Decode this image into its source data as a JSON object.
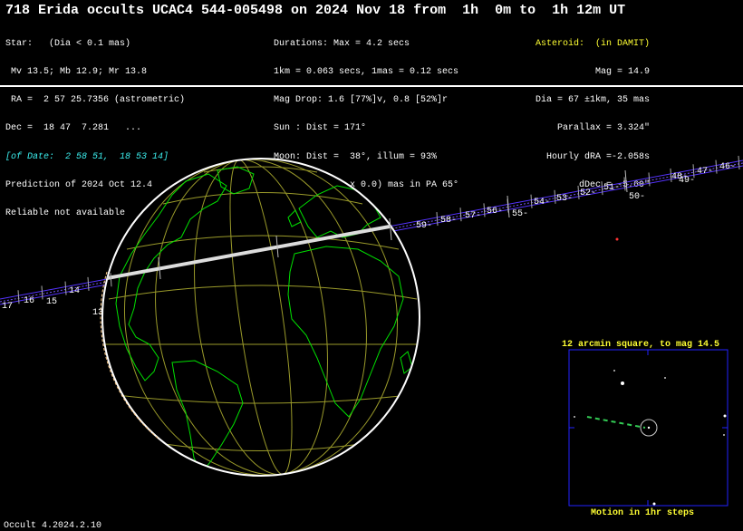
{
  "title": "718 Erida occults UCAC4 544-005498 on 2024 Nov 18 from  1h  0m to  1h 12m UT",
  "star_info": [
    "Star:   (Dia < 0.1 mas)",
    " Mv 13.5; Mb 12.9; Mr 13.8",
    " RA =  2 57 25.7356 (astrometric)",
    "Dec =  18 47  7.281   ...",
    "[of Date:  2 58 51,  18 53 14]",
    "Prediction of 2024 Oct 12.4",
    "Reliable not available"
  ],
  "event_info": [
    "Durations: Max = 4.2 secs",
    "1km = 0.063 secs, 1mas = 0.12 secs",
    "Mag Drop: 1.6 [77%]v, 0.8 [52%]r",
    "Sun : Dist = 171°",
    "Moon: Dist =  38°, illum = 93%",
    "1σ Err: ±(2.0 x 0.0) mas in PA 65°"
  ],
  "asteroid_info": {
    "heading": "Asteroid:  (in DAMIT)",
    "lines": [
      "Mag = 14.9",
      "Dia = 67 ±1km, 35 mas",
      "Parallax = 3.324\"",
      "Hourly dRA =-2.058s",
      "dDec = -5.60\""
    ]
  },
  "path_ticks": [
    {
      "label": "17"
    },
    {
      "label": "16"
    },
    {
      "label": "15"
    },
    {
      "label": "14"
    },
    {
      "label": "13"
    },
    {
      "label": "59-"
    },
    {
      "label": "58-"
    },
    {
      "label": "57-"
    },
    {
      "label": "56-"
    },
    {
      "label": "55-"
    },
    {
      "label": "54-"
    },
    {
      "label": "53-"
    },
    {
      "label": "52-"
    },
    {
      "label": "51-"
    },
    {
      "label": "50-"
    },
    {
      "label": "49-"
    },
    {
      "label": "48-"
    },
    {
      "label": "47-"
    },
    {
      "label": "46-"
    }
  ],
  "finder": {
    "title": "12 arcmin square, to mag 14.5",
    "caption": "Motion in 1hr steps"
  },
  "footer": "Occult 4.2024.2.10",
  "colors": {
    "coastline": "#00e000",
    "graticule": "#9a9a2a",
    "path": "#5533ff",
    "finder_frame": "#2222ff",
    "label_yellow": "#ffff33",
    "info_cyan": "#3cf0f0"
  }
}
